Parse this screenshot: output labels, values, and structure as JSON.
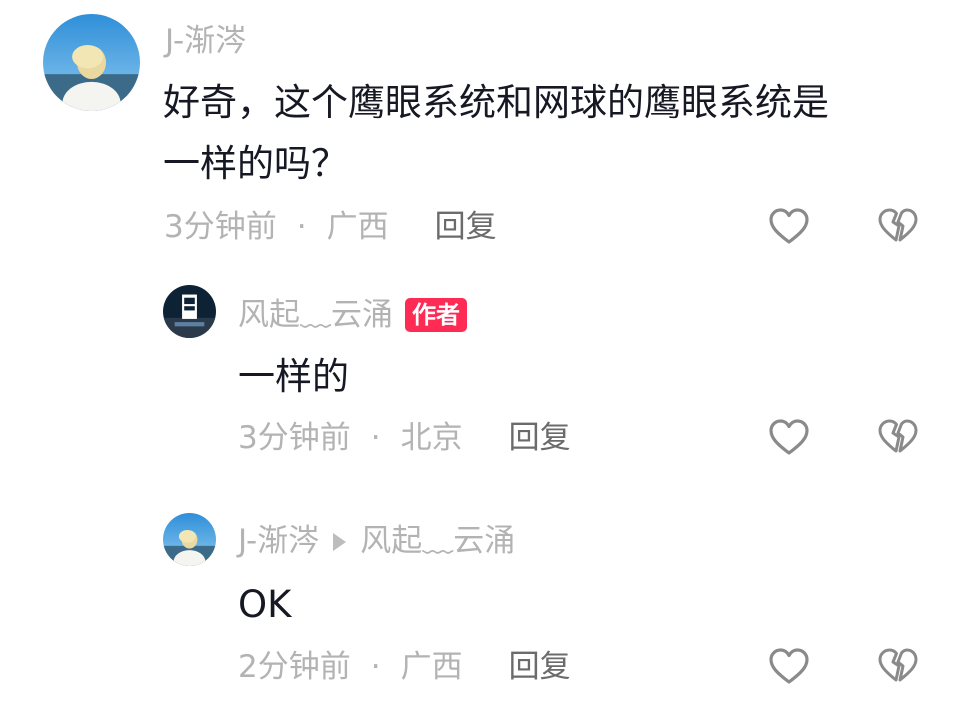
{
  "comments": [
    {
      "author": "J-渐涔",
      "text_line1": "好奇，这个鹰眼系统和网球的鹰眼系统是",
      "text_line2": "一样的吗？",
      "time": "3分钟前",
      "dot": "·",
      "location": "广西",
      "reply_label": "回复",
      "avatar_icon": "avatar-blonde-person-icon"
    },
    {
      "author": "风起﹏云涌",
      "badge": "作者",
      "text": "一样的",
      "time": "3分钟前",
      "dot": "·",
      "location": "北京",
      "reply_label": "回复",
      "avatar_icon": "avatar-tower-icon"
    },
    {
      "author": "J-渐涔",
      "reply_to": "风起﹏云涌",
      "text": "OK",
      "time": "2分钟前",
      "dot": "·",
      "location": "广西",
      "reply_label": "回复",
      "avatar_icon": "avatar-blonde-person-icon"
    }
  ],
  "colors": {
    "text": "#161823",
    "muted": "#b3b3b3",
    "reply": "#6b6b6b",
    "badge": "#fe2c55",
    "icon": "#8a8a8a"
  }
}
